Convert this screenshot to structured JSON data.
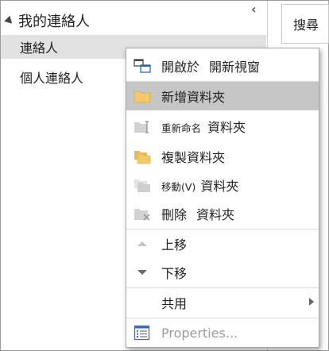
{
  "nav": {
    "header": "我的連絡人",
    "items": [
      {
        "label": "連絡人",
        "selected": true
      },
      {
        "label": "個人連絡人",
        "selected": false
      }
    ]
  },
  "search": {
    "label": "搜尋"
  },
  "menu": {
    "items": [
      {
        "label_a": "開啟於",
        "label_b": "開新視窗",
        "icon": "open-new-window-icon"
      },
      {
        "label": "新增資料夾",
        "icon": "new-folder-icon",
        "highlighted": true
      },
      {
        "label_a": "重新命名",
        "label_b": "資料夾",
        "icon": "rename-folder-icon"
      },
      {
        "label": "複製資料夾",
        "icon": "copy-folder-icon"
      },
      {
        "label_a": "移動(V)",
        "label_b": "資料夾",
        "icon": "move-folder-icon"
      },
      {
        "label_a": "刪除",
        "label_b": "資料夾",
        "icon": "delete-folder-icon"
      },
      {
        "label": "上移",
        "icon": "move-up-icon"
      },
      {
        "label": "下移",
        "icon": "move-down-icon"
      },
      {
        "label": "共用",
        "icon": "chevron-right-icon"
      },
      {
        "label": "Properties...",
        "icon": "properties-icon"
      }
    ]
  },
  "colors": {
    "highlight": "#c6c6c6",
    "selected_nav": "#e1e1e1",
    "folder_yellow": "#f2c96a",
    "disabled_gray": "#c4c4c4",
    "properties_blue": "#3a6eb5"
  }
}
